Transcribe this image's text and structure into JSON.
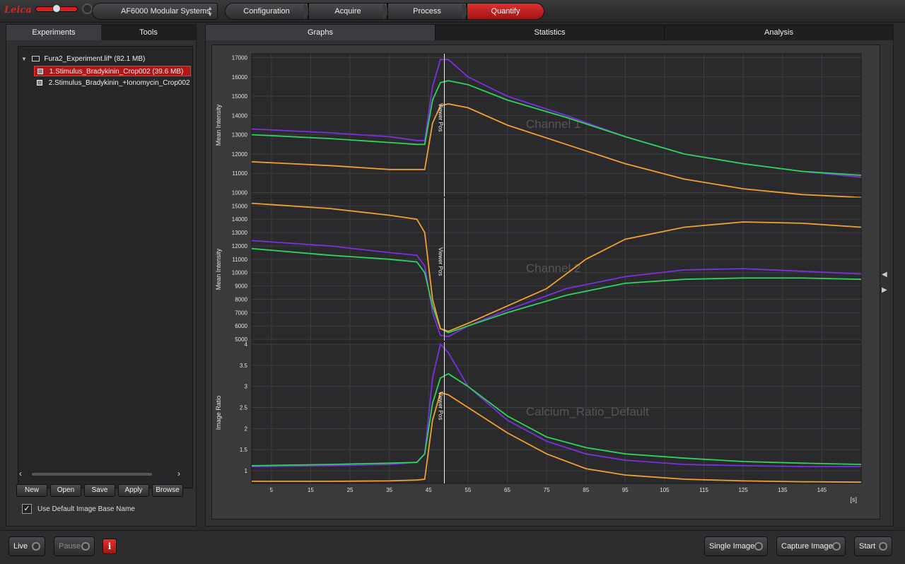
{
  "topbar": {
    "logo_text": "Leica",
    "system": "AF6000 Modular Systems",
    "steps": [
      {
        "label": "Configuration",
        "active": false
      },
      {
        "label": "Acquire",
        "active": false
      },
      {
        "label": "Process",
        "active": false
      },
      {
        "label": "Quantify",
        "active": true
      }
    ]
  },
  "left_panel": {
    "tabs": [
      {
        "label": "Experiments",
        "active": true
      },
      {
        "label": "Tools",
        "active": false
      }
    ],
    "tree": {
      "root": "Fura2_Experiment.lif*  (82.1 MB)",
      "items": [
        {
          "label": "1.Stimulus_Bradykinin_Crop002 (39.6 MB)",
          "selected": true
        },
        {
          "label": "2.Stimulus_Bradykinin_+Ionomycin_Crop002",
          "selected": false
        }
      ]
    },
    "buttons": [
      "New",
      "Open",
      "Save",
      "Apply",
      "Browse"
    ],
    "checkbox": {
      "label": "Use Default Image Base Name",
      "checked": true
    }
  },
  "right_panel": {
    "tabs": [
      {
        "label": "Graphs",
        "active": true
      },
      {
        "label": "Statistics",
        "active": false
      },
      {
        "label": "Analysis",
        "active": false
      }
    ]
  },
  "chart_data": [
    {
      "type": "line",
      "title": "Channel 1",
      "ylabel": "Mean Intensity",
      "ylim": [
        9800,
        17200
      ],
      "yticks": [
        10000,
        11000,
        12000,
        13000,
        14000,
        15000,
        16000,
        17000
      ],
      "xlim": [
        0,
        155
      ],
      "marker": {
        "x": 49,
        "label": "Viewer Pos"
      },
      "series": [
        {
          "color": "#7b2fe0",
          "points": [
            [
              0,
              13300
            ],
            [
              20,
              13100
            ],
            [
              35,
              12900
            ],
            [
              42,
              12700
            ],
            [
              44,
              12700
            ],
            [
              46,
              15500
            ],
            [
              48,
              16900
            ],
            [
              50,
              16900
            ],
            [
              55,
              16000
            ],
            [
              65,
              15000
            ],
            [
              80,
              14000
            ],
            [
              95,
              12900
            ],
            [
              110,
              12000
            ],
            [
              125,
              11500
            ],
            [
              140,
              11100
            ],
            [
              155,
              10800
            ]
          ]
        },
        {
          "color": "#2ed45a",
          "points": [
            [
              0,
              13000
            ],
            [
              20,
              12800
            ],
            [
              35,
              12600
            ],
            [
              42,
              12500
            ],
            [
              44,
              12500
            ],
            [
              46,
              14800
            ],
            [
              48,
              15700
            ],
            [
              50,
              15800
            ],
            [
              55,
              15600
            ],
            [
              65,
              14800
            ],
            [
              80,
              13900
            ],
            [
              95,
              12900
            ],
            [
              110,
              12000
            ],
            [
              125,
              11500
            ],
            [
              140,
              11100
            ],
            [
              155,
              10900
            ]
          ]
        },
        {
          "color": "#f0a030",
          "points": [
            [
              0,
              11600
            ],
            [
              20,
              11400
            ],
            [
              35,
              11200
            ],
            [
              42,
              11200
            ],
            [
              44,
              11200
            ],
            [
              46,
              13600
            ],
            [
              48,
              14500
            ],
            [
              50,
              14600
            ],
            [
              55,
              14400
            ],
            [
              65,
              13500
            ],
            [
              80,
              12500
            ],
            [
              95,
              11500
            ],
            [
              110,
              10700
            ],
            [
              125,
              10200
            ],
            [
              140,
              9900
            ],
            [
              155,
              9750
            ]
          ]
        }
      ]
    },
    {
      "type": "line",
      "title": "Channel 2",
      "ylabel": "Mean Intensity",
      "ylim": [
        4900,
        15600
      ],
      "yticks": [
        5000,
        6000,
        7000,
        8000,
        9000,
        10000,
        11000,
        12000,
        13000,
        14000,
        15000
      ],
      "xlim": [
        0,
        155
      ],
      "marker": {
        "x": 49,
        "label": "Viewer Pos"
      },
      "series": [
        {
          "color": "#7b2fe0",
          "points": [
            [
              0,
              12400
            ],
            [
              20,
              12000
            ],
            [
              35,
              11500
            ],
            [
              42,
              11300
            ],
            [
              44,
              10500
            ],
            [
              46,
              7000
            ],
            [
              48,
              5300
            ],
            [
              50,
              5200
            ],
            [
              55,
              6000
            ],
            [
              65,
              7200
            ],
            [
              80,
              8800
            ],
            [
              95,
              9700
            ],
            [
              110,
              10200
            ],
            [
              125,
              10300
            ],
            [
              140,
              10100
            ],
            [
              155,
              9900
            ]
          ]
        },
        {
          "color": "#2ed45a",
          "points": [
            [
              0,
              11800
            ],
            [
              20,
              11300
            ],
            [
              35,
              11000
            ],
            [
              42,
              10800
            ],
            [
              44,
              10000
            ],
            [
              46,
              7500
            ],
            [
              48,
              5800
            ],
            [
              50,
              5500
            ],
            [
              55,
              6000
            ],
            [
              65,
              7000
            ],
            [
              80,
              8300
            ],
            [
              95,
              9200
            ],
            [
              110,
              9500
            ],
            [
              125,
              9600
            ],
            [
              140,
              9600
            ],
            [
              155,
              9500
            ]
          ]
        },
        {
          "color": "#f0a030",
          "points": [
            [
              0,
              15200
            ],
            [
              20,
              14800
            ],
            [
              35,
              14300
            ],
            [
              42,
              14000
            ],
            [
              44,
              13000
            ],
            [
              46,
              8000
            ],
            [
              48,
              5800
            ],
            [
              50,
              5600
            ],
            [
              55,
              6200
            ],
            [
              65,
              7500
            ],
            [
              75,
              8800
            ],
            [
              85,
              11000
            ],
            [
              95,
              12500
            ],
            [
              110,
              13400
            ],
            [
              125,
              13800
            ],
            [
              140,
              13700
            ],
            [
              155,
              13400
            ]
          ]
        }
      ]
    },
    {
      "type": "line",
      "title": "Calcium_Ratio_Default",
      "ylabel": "Image Ratio",
      "ylim": [
        0.7,
        4.05
      ],
      "yticks": [
        1,
        1.5,
        2,
        2.5,
        3,
        3.5,
        4
      ],
      "yticklabels": [
        "1",
        "1.5",
        "2",
        "2.5",
        "3",
        "3.5",
        "4"
      ],
      "xlim": [
        0,
        155
      ],
      "xticks": [
        5,
        15,
        25,
        35,
        45,
        55,
        65,
        75,
        85,
        95,
        105,
        115,
        125,
        135,
        145
      ],
      "xunit": "[s]",
      "marker": {
        "x": 49,
        "label": "Viewer Pos"
      },
      "series": [
        {
          "color": "#7b2fe0",
          "points": [
            [
              0,
              1.1
            ],
            [
              20,
              1.12
            ],
            [
              35,
              1.15
            ],
            [
              42,
              1.2
            ],
            [
              44,
              1.4
            ],
            [
              46,
              3.2
            ],
            [
              48,
              4.0
            ],
            [
              50,
              3.8
            ],
            [
              55,
              3.0
            ],
            [
              65,
              2.2
            ],
            [
              75,
              1.7
            ],
            [
              85,
              1.4
            ],
            [
              95,
              1.25
            ],
            [
              110,
              1.15
            ],
            [
              125,
              1.12
            ],
            [
              140,
              1.1
            ],
            [
              155,
              1.1
            ]
          ]
        },
        {
          "color": "#2ed45a",
          "points": [
            [
              0,
              1.12
            ],
            [
              20,
              1.15
            ],
            [
              35,
              1.18
            ],
            [
              42,
              1.2
            ],
            [
              44,
              1.4
            ],
            [
              46,
              2.6
            ],
            [
              48,
              3.2
            ],
            [
              50,
              3.3
            ],
            [
              55,
              3.0
            ],
            [
              65,
              2.3
            ],
            [
              75,
              1.8
            ],
            [
              85,
              1.55
            ],
            [
              95,
              1.4
            ],
            [
              110,
              1.3
            ],
            [
              125,
              1.22
            ],
            [
              140,
              1.18
            ],
            [
              155,
              1.15
            ]
          ]
        },
        {
          "color": "#f0a030",
          "points": [
            [
              0,
              0.75
            ],
            [
              20,
              0.75
            ],
            [
              35,
              0.76
            ],
            [
              42,
              0.78
            ],
            [
              44,
              0.8
            ],
            [
              46,
              2.2
            ],
            [
              48,
              2.85
            ],
            [
              50,
              2.8
            ],
            [
              55,
              2.5
            ],
            [
              65,
              1.9
            ],
            [
              75,
              1.4
            ],
            [
              85,
              1.05
            ],
            [
              95,
              0.9
            ],
            [
              110,
              0.8
            ],
            [
              125,
              0.76
            ],
            [
              140,
              0.74
            ],
            [
              155,
              0.73
            ]
          ]
        }
      ]
    }
  ],
  "bottombar": {
    "live": "Live",
    "pause": "Pause",
    "single_image": "Single Image",
    "capture_image": "Capture Image",
    "start": "Start"
  }
}
